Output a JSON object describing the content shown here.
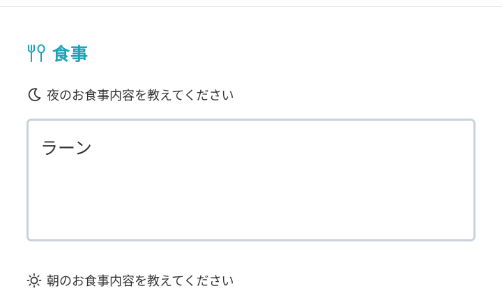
{
  "meals_section": {
    "icon": "fork-and-spoon-icon",
    "title": "食事",
    "accent_color": "#1aa4b8"
  },
  "dinner": {
    "icon": "crescent-moon-icon",
    "label": "夜のお食事内容を教えてください",
    "value": "ラーン"
  },
  "breakfast": {
    "icon": "sun-icon",
    "label": "朝のお食事内容を教えてください"
  }
}
